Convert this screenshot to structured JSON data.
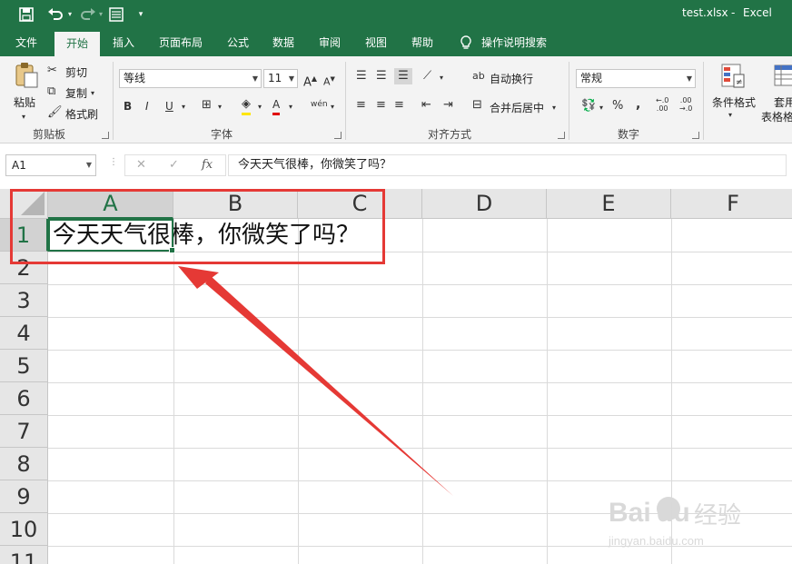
{
  "titlebar": {
    "document_title": "test.xlsx",
    "separator": "-",
    "app_name": "Excel",
    "colors": {
      "brand": "#217346"
    }
  },
  "quick_access": {
    "save_icon": "save-icon",
    "undo_icon": "undo-icon",
    "redo_icon": "redo-icon",
    "form_icon": "form-icon",
    "customize_icon": "customize-qat-icon"
  },
  "tabs": [
    {
      "label": "文件",
      "active": false
    },
    {
      "label": "开始",
      "active": true
    },
    {
      "label": "插入",
      "active": false
    },
    {
      "label": "页面布局",
      "active": false
    },
    {
      "label": "公式",
      "active": false
    },
    {
      "label": "数据",
      "active": false
    },
    {
      "label": "审阅",
      "active": false
    },
    {
      "label": "视图",
      "active": false
    },
    {
      "label": "帮助",
      "active": false
    },
    {
      "label": "操作说明搜索",
      "active": false
    }
  ],
  "ribbon": {
    "clipboard": {
      "label": "剪贴板",
      "paste": "粘贴",
      "cut": "剪切",
      "copy": "复制",
      "format_painter": "格式刷"
    },
    "font": {
      "label": "字体",
      "font_name": "等线",
      "font_size": "11",
      "bold": "B",
      "italic": "I",
      "underline": "U",
      "pinyin": "wén"
    },
    "alignment": {
      "label": "对齐方式",
      "wrap_text": "自动换行",
      "merge_center": "合并后居中"
    },
    "number": {
      "label": "数字",
      "format": "常规",
      "percent": "%",
      "comma": ","
    },
    "styles": {
      "conditional_formatting": "条件格式",
      "table_format_line1": "套用",
      "table_format_line2": "表格格"
    }
  },
  "formula_bar": {
    "name_box": "A1",
    "fx": "fx",
    "content": "今天天气很棒，你微笑了吗？"
  },
  "sheet": {
    "columns": [
      "A",
      "B",
      "C",
      "D",
      "E",
      "F"
    ],
    "rows": [
      "1",
      "2",
      "3",
      "4",
      "5",
      "6",
      "7",
      "8",
      "9",
      "10",
      "11"
    ],
    "active_cell": "A1",
    "cell_a1_text": "今天天气很棒，你微笑了吗？"
  },
  "watermark": {
    "brand": "Bai",
    "brand_suffix": "du",
    "product": "经验",
    "url": "jingyan.baidu.com"
  }
}
